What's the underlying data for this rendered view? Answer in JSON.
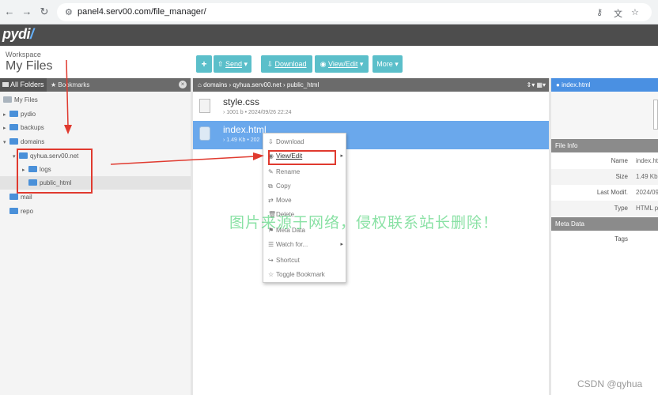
{
  "browser": {
    "url": "panel4.serv00.com/file_manager/",
    "back": "←",
    "forward": "→",
    "reload": "↻",
    "site_icon": "⚙",
    "right_icons": [
      "⚷",
      "文",
      "☆"
    ]
  },
  "app": {
    "logo_text": "pydi",
    "logo_mark": "/",
    "workspace_label": "Workspace",
    "workspace_title": "My Files"
  },
  "toolbar": {
    "new_icon": "+",
    "send_label": "Send",
    "send_icon": "⇧",
    "download_label": "Download",
    "download_icon": "⇩",
    "view_edit_label": "View/Edit",
    "view_edit_icon": "◉",
    "more_label": "More",
    "caret": "▾"
  },
  "left_panel": {
    "tab_folders": "All Folders",
    "tab_bookmarks": "Bookmarks",
    "close": "×",
    "tree": [
      {
        "label": "My Files",
        "caret": ""
      },
      {
        "label": "pydio",
        "caret": "▸"
      },
      {
        "label": "backups",
        "caret": "▸"
      },
      {
        "label": "domains",
        "caret": "▾"
      },
      {
        "label": "qyhua.serv00.net",
        "caret": "▾"
      },
      {
        "label": "logs",
        "caret": "▸"
      },
      {
        "label": "public_html",
        "caret": ""
      },
      {
        "label": "mail",
        "caret": ""
      },
      {
        "label": "repo",
        "caret": ""
      }
    ]
  },
  "breadcrumb": {
    "path": "domains › qyhua.serv00.net › public_html",
    "icons": "⇕▾ ▦▾"
  },
  "files": [
    {
      "name": "style.css",
      "meta": "› 1001 b  •  2024/09/26 22:24"
    },
    {
      "name": "index.html",
      "meta": "› 1.49 Kb  •  202"
    }
  ],
  "context_menu": {
    "items": [
      {
        "label": "Download",
        "icon": "⇩",
        "arrow": ""
      },
      {
        "label": "View/Edit",
        "icon": "◉",
        "arrow": "▸"
      },
      {
        "label": "Rename",
        "icon": "✎",
        "arrow": ""
      },
      {
        "label": "Copy",
        "icon": "⧉",
        "arrow": ""
      },
      {
        "label": "Move",
        "icon": "⇄",
        "arrow": ""
      },
      {
        "label": "Delete",
        "icon": "🗑",
        "arrow": ""
      },
      {
        "label": "Meta Data",
        "icon": "⚑",
        "arrow": ""
      },
      {
        "label": "Watch for...",
        "icon": "☰",
        "arrow": "▸"
      },
      {
        "label": "Shortcut",
        "icon": "↪",
        "arrow": ""
      },
      {
        "label": "Toggle Bookmark",
        "icon": "☆",
        "arrow": ""
      }
    ]
  },
  "right_panel": {
    "title": "index.html",
    "file_info_label": "File Info",
    "info": [
      {
        "label": "Name",
        "value": "index.htm"
      },
      {
        "label": "Size",
        "value": "1.49 Kb"
      },
      {
        "label": "Last Modif.",
        "value": "2024/09"
      },
      {
        "label": "Type",
        "value": "HTML p"
      }
    ],
    "meta_data_label": "Meta Data",
    "tags_label": "Tags"
  },
  "overlay": {
    "watermark": "图片来源于网络，侵权联系站长删除！",
    "credit": "CSDN @qyhua"
  },
  "colors": {
    "accent": "#5bbfca",
    "selection": "#6aa8ec",
    "header": "#4d4d4d",
    "annotation": "#e03a2f"
  }
}
